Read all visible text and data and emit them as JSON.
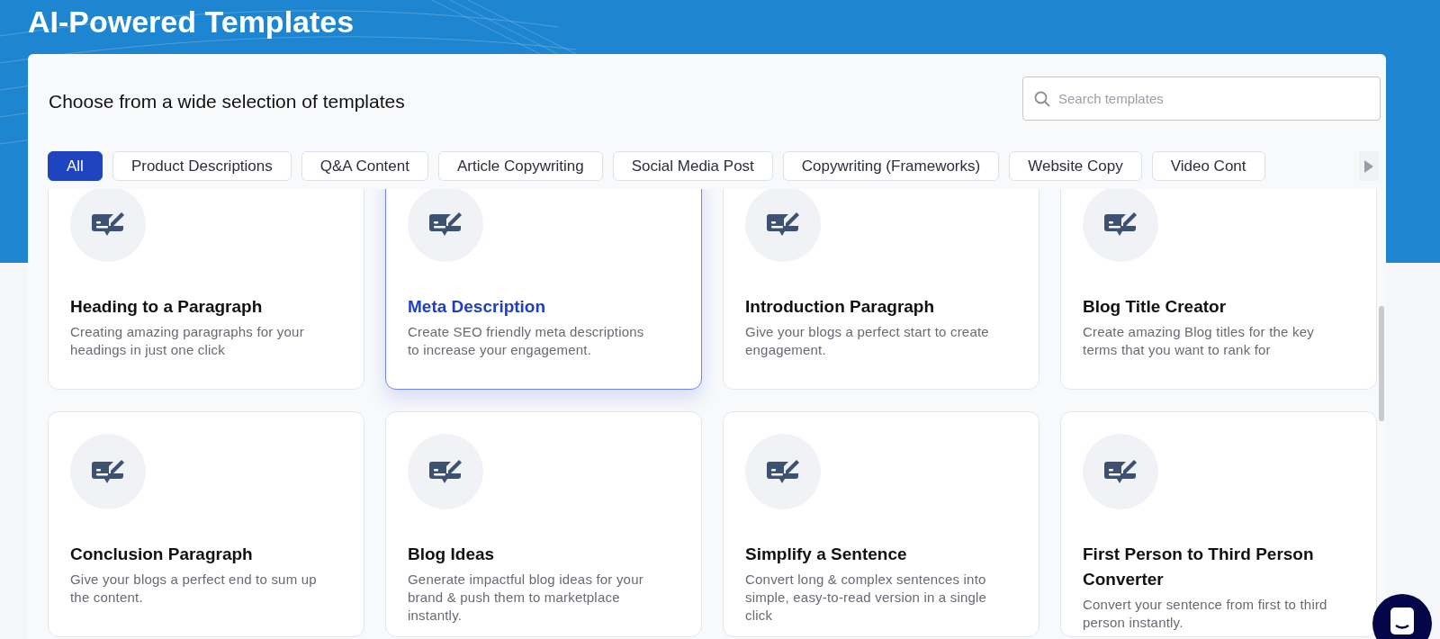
{
  "header": {
    "title": "AI-Powered Templates"
  },
  "panel": {
    "heading": "Choose from a wide selection of templates"
  },
  "search": {
    "placeholder": "Search templates"
  },
  "tabs": [
    {
      "label": "All",
      "selected": true
    },
    {
      "label": "Product Descriptions",
      "selected": false
    },
    {
      "label": "Q&A Content",
      "selected": false
    },
    {
      "label": "Article Copywriting",
      "selected": false
    },
    {
      "label": "Social Media Post",
      "selected": false
    },
    {
      "label": "Copywriting (Frameworks)",
      "selected": false
    },
    {
      "label": "Website Copy",
      "selected": false
    },
    {
      "label": "Video Cont",
      "selected": false
    }
  ],
  "templates": [
    {
      "title": "Heading to a Paragraph",
      "description": "Creating amazing paragraphs for your headings in just one click",
      "selected": false
    },
    {
      "title": "Meta Description",
      "description": "Create SEO friendly meta descriptions to increase your engagement.",
      "selected": true
    },
    {
      "title": "Introduction Paragraph",
      "description": "Give your blogs a perfect start to create engagement.",
      "selected": false
    },
    {
      "title": "Blog Title Creator",
      "description": "Create amazing Blog titles for the key terms that you want to rank for",
      "selected": false
    },
    {
      "title": "Conclusion Paragraph",
      "description": "Give your blogs a perfect end to sum up the content.",
      "selected": false
    },
    {
      "title": "Blog Ideas",
      "description": "Generate impactful blog ideas for your brand & push them to marketplace instantly.",
      "selected": false
    },
    {
      "title": "Simplify a Sentence",
      "description": "Convert long & complex sentences into simple, easy-to-read version in a single click",
      "selected": false
    },
    {
      "title": "First Person to Third Person Converter",
      "description": "Convert your sentence from first to third person instantly.",
      "selected": false
    }
  ]
}
